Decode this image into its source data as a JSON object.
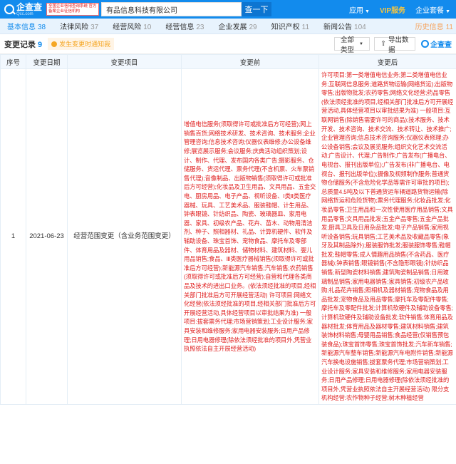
{
  "header": {
    "logo_cn": "企查查",
    "logo_en": "Qcc.com",
    "gov_badge": "全国企业信用查询系统 官方备案企业征信机构",
    "search_value": "有品信息科技有限公司",
    "search_button": "查一下",
    "nav": {
      "apps": "应用",
      "vip": "VIP服务",
      "enterprise": "企业套餐"
    }
  },
  "tabs": [
    {
      "label": "基本信息",
      "count": "38"
    },
    {
      "label": "法律风险",
      "count": "37"
    },
    {
      "label": "经营风险",
      "count": "10"
    },
    {
      "label": "经营信息",
      "count": "23"
    },
    {
      "label": "企业发展",
      "count": "29"
    },
    {
      "label": "知识产权",
      "count": "11"
    },
    {
      "label": "新闻公告",
      "count": "104"
    },
    {
      "label": "历史信息",
      "count": "11"
    }
  ],
  "toolbar": {
    "title": "变更记录",
    "count": "9",
    "tip": "发生变更时通知我",
    "select_label": "全部类型",
    "export_label": "导出数据",
    "watermark": "企查查"
  },
  "table": {
    "headers": [
      "序号",
      "变更日期",
      "变更项目",
      "变更前",
      "变更后"
    ],
    "rows": [
      {
        "index": "1",
        "date": "2021-06-23",
        "item": "经营范围变更（含业务范围变更）",
        "before": "增值电信服务(须取得许可或批准后方可经营);网上销售百货;网络技术研发、技术咨询、技术服务;企业管理咨询;信息技术咨询;仪器仪表维修;办公设备维修;展览展示服务;会议服务;庆典活动组织策划;设计、制作、代理、发布国内各类广告;摄影服务、仓储服务、货运代理、票务代理(不含机票、火车票销售代理);音像制品、出版物销售(须取得许可或批准后方可经营);化妆品及卫生用品、文具用品、五金交电、厨房用品、电子产品、视听设备、Ⅰ类Ⅱ类医疗器械、玩具、工艺美术品、服装鞋帽、计生用品、钟表眼镜、针纺织品、陶瓷、玻璃器皿、家用电器、家具、初级农产品、花卉、苗木、动物用清洁剂、种子、照相器材、礼品、计算机硬件、软件及辅助设备、珠宝首饰、宠物食品、摩托车及零部件、体育用品及器材、储物材料、建筑材料、婴儿用品销售;食品、Ⅲ类医疗器械销售(须取得许可或批准后方可经营);新能源汽车销售;汽车销售;农药销售(须取得许可或批准后方可经营);自营和代理各类商品及技术的进出口业务。(依法须经批准的项目,经相关部门批准后方可开展经营活动) 许可项目:网络文化经营(依法须经批准的项目,经相关部门批准后方可开展经营活动,具体经营项目以审批结果为准) 一般项目:拔套票务代理;市场营销策划;工业设计服务;家具安装和维修服务;家用电器安装服务;日用产品修理;日用电器修理(除依法须经批准的项目外,凭营业执照依法自主开展经营活动)",
        "after": "许可项目:第一类增值电信业务;第二类增值电信业务;互联网信息服务;道路货物运输(网络货运);出版物零售;出版物批发;农药零售;网络文化经营;药品零售(依法须经批准的项目,经相关部门批准后方可开展经营活动,具体经营项目以审批结果为准) 一般项目:互联网销售(除销售需要许可的商品);技术服务、技术开发、技术咨询、技术交流、技术转让、技术推广;企业管理咨询;信息技术咨询服务;仪器仪表修理;办公设备销售;会议及展览服务;组织文化艺术交流活动;广告设计、代理;广告制作;广告发布(广播电台、电视台、报刊出版单位);广告发布(非广播电台、电视台、报刊出版单位);摄像及视频制作服务;普通货物仓储服务(不含危险化学品等需许可审批的项目);总质量4.5吨及以下普通货运车辆道路货物运输(除网络货运和危险货物);票务代理服务;化妆品批发;化妆品零售;卫生用品和一次性使用医疗用品销售;文具用品零售;文具用品批发;五金产品零售;五金产品批发;厨具卫具及日用杂品批发;电子产品销售;家用视听设备销售;玩具销售;工艺美术品及收藏品零售(象牙及其制品除外);服装服饰批发;服装服饰零售;鞋帽批发;鞋帽零售;成人情趣用品销售(不含药品、医疗器械);钟表销售;眼镜销售(不含隐形眼镜);针纺织品销售;新型陶瓷材料销售;建筑陶瓷制品销售;日用玻璃制品销售;家用电器销售;家具销售;初级农产品收购;礼品花卉销售;照相机及器材销售;宠物食品及用品批发;宠物食品及用品零售;摩托车及零配件零售;摩托车及零配件批发;计算机软硬件及辅助设备零售;计算机软硬件及辅助设备批发;软件销售;体育用品及器材批发;体育用品及器材零售;建筑材料销售;建筑装饰材料销售;母婴用品销售;食品经营(仅销售预包装食品);珠宝首饰零售;珠宝首饰批发;汽车新车销售;新能源汽车整车销售;新能源汽车电附件销售;新能源汽车换电设施销售;拔套票务代理;市场营销策划;工业设计服务;家具安装和维修服务;家用电器安装服务;日用产品修理;日用电器修理(除依法须经批准的项目外,凭营业执照依法自主开展经营活动) 限分支机构经营:农作物种子经营;树木种植经营"
      }
    ]
  }
}
